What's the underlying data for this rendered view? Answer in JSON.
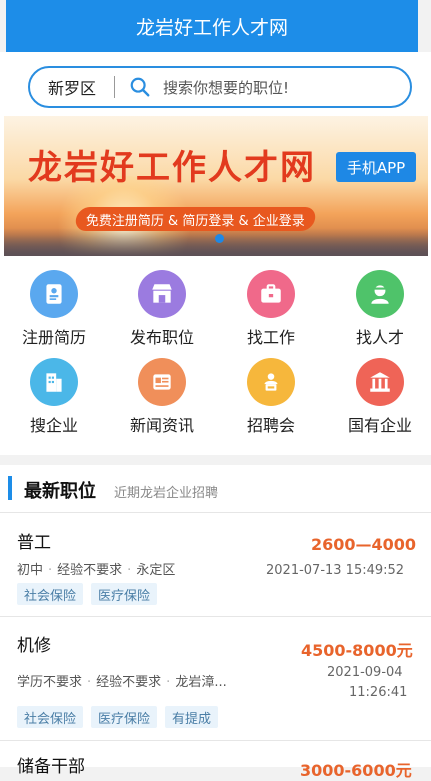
{
  "app": {
    "title": "龙岩好工作人才网"
  },
  "search": {
    "region": "新罗区",
    "placeholder": "搜索你想要的职位!"
  },
  "banner": {
    "title": "龙岩好工作人才网",
    "badge": "手机APP",
    "subtitle": "免费注册简历 & 简历登录 & 企业登录"
  },
  "quick_menu": [
    {
      "label": "注册简历",
      "icon": "resume-icon",
      "color": "#5aa8ef"
    },
    {
      "label": "发布职位",
      "icon": "store-icon",
      "color": "#9b7be0"
    },
    {
      "label": "找工作",
      "icon": "briefcase-icon",
      "color": "#f0698a"
    },
    {
      "label": "找人才",
      "icon": "person-icon",
      "color": "#4fc36a"
    },
    {
      "label": "搜企业",
      "icon": "building-icon",
      "color": "#4bb7e8"
    },
    {
      "label": "新闻资讯",
      "icon": "news-icon",
      "color": "#f08f5a"
    },
    {
      "label": "招聘会",
      "icon": "job-fair-icon",
      "color": "#f6b73c"
    },
    {
      "label": "国有企业",
      "icon": "bank-icon",
      "color": "#ef6457"
    }
  ],
  "section": {
    "title": "最新职位",
    "subtitle": "近期龙岩企业招聘"
  },
  "jobs": [
    {
      "title": "普工",
      "salary": "2600—4000",
      "meta": [
        "初中",
        "经验不要求",
        "永定区"
      ],
      "time": "2021-07-13 15:49:52",
      "tags": [
        "社会保险",
        "医疗保险"
      ]
    },
    {
      "title": "机修",
      "salary": "4500-8000元",
      "meta": [
        "学历不要求",
        "经验不要求",
        "龙岩漳..."
      ],
      "time_date": "2021-09-04",
      "time_clock": "11:26:41",
      "tags": [
        "社会保险",
        "医疗保险",
        "有提成"
      ]
    },
    {
      "title": "储备干部",
      "salary": "3000-6000元"
    }
  ]
}
